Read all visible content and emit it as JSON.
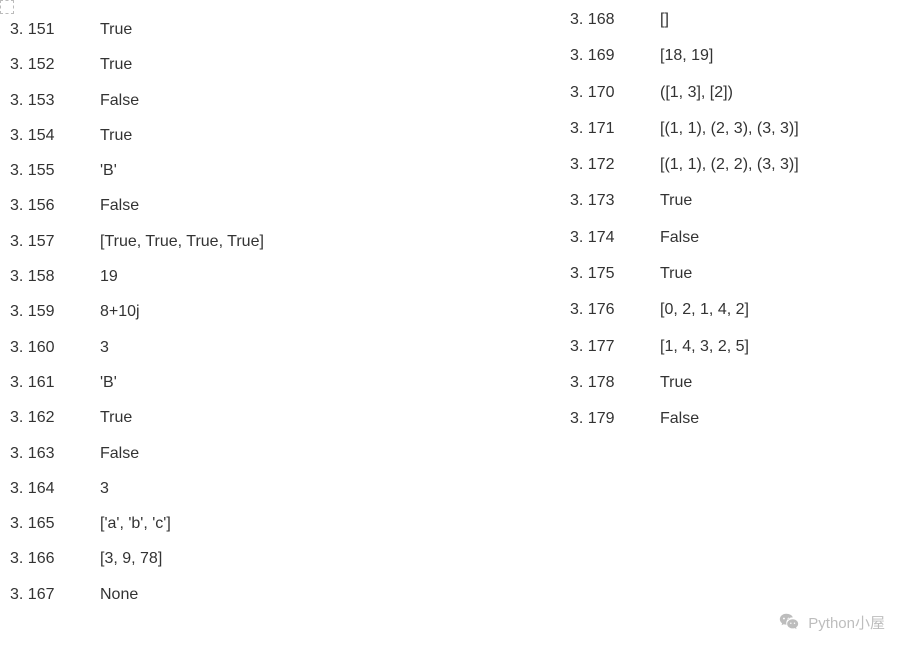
{
  "left_column": [
    {
      "num": "3. 151",
      "val": "True"
    },
    {
      "num": "3. 152",
      "val": "True"
    },
    {
      "num": "3. 153",
      "val": "False"
    },
    {
      "num": "3. 154",
      "val": "True"
    },
    {
      "num": "3. 155",
      "val": "'B'"
    },
    {
      "num": "3. 156",
      "val": "False"
    },
    {
      "num": "3. 157",
      "val": "[True, True, True, True]"
    },
    {
      "num": "3. 158",
      "val": "19"
    },
    {
      "num": "3. 159",
      "val": "8+10j"
    },
    {
      "num": "3. 160",
      "val": "3"
    },
    {
      "num": "3. 161",
      "val": "'B'"
    },
    {
      "num": "3. 162",
      "val": "True"
    },
    {
      "num": "3. 163",
      "val": "False"
    },
    {
      "num": "3. 164",
      "val": "3"
    },
    {
      "num": "3. 165",
      "val": "['a', 'b', 'c']"
    },
    {
      "num": "3. 166",
      "val": "[3, 9, 78]"
    },
    {
      "num": "3. 167",
      "val": "None"
    }
  ],
  "right_column": [
    {
      "num": "3. 168",
      "val": "[]"
    },
    {
      "num": "3. 169",
      "val": "[18, 19]"
    },
    {
      "num": "3. 170",
      "val": "([1, 3], [2])"
    },
    {
      "num": "3. 171",
      "val": "[(1, 1), (2, 3), (3, 3)]"
    },
    {
      "num": "3. 172",
      "val": "[(1, 1), (2, 2), (3, 3)]"
    },
    {
      "num": "3. 173",
      "val": "True"
    },
    {
      "num": "3. 174",
      "val": "False"
    },
    {
      "num": "3. 175",
      "val": "True"
    },
    {
      "num": "3. 176",
      "val": "[0, 2, 1, 4, 2]"
    },
    {
      "num": "3. 177",
      "val": "[1, 4, 3, 2, 5]"
    },
    {
      "num": "3. 178",
      "val": "True"
    },
    {
      "num": "3. 179",
      "val": "False"
    }
  ],
  "watermark": {
    "text": "Python小屋"
  }
}
